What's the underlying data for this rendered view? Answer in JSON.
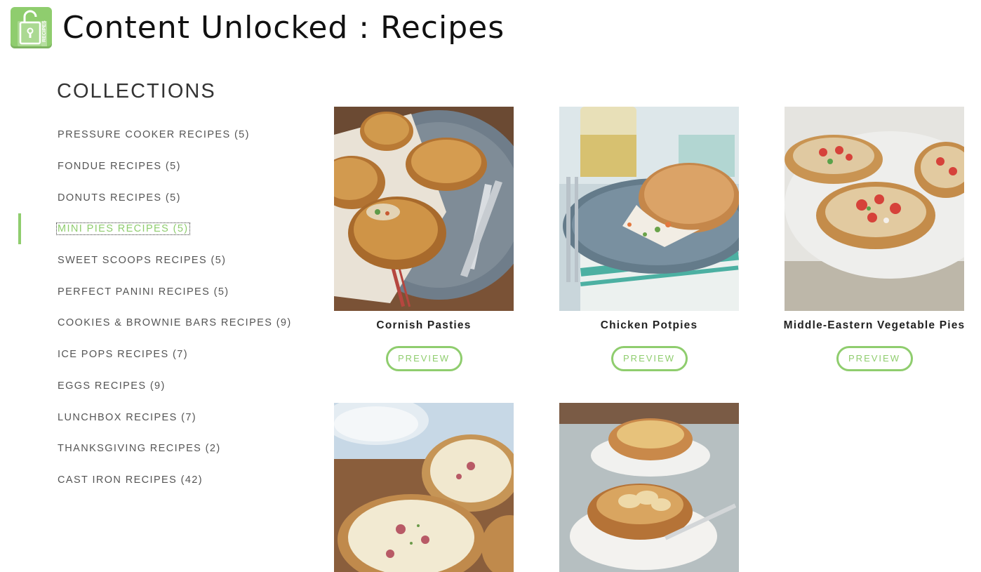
{
  "header": {
    "title": "Content Unlocked : Recipes",
    "logo_icon": "unlocked-book-icon",
    "logo_text": "RECIPES",
    "brand_color": "#8fcd6e"
  },
  "sidebar": {
    "heading": "COLLECTIONS",
    "items": [
      {
        "label": "PRESSURE COOKER RECIPES (5)",
        "active": false
      },
      {
        "label": "FONDUE RECIPES (5)",
        "active": false
      },
      {
        "label": "DONUTS RECIPES (5)",
        "active": false
      },
      {
        "label": "MINI PIES RECIPES (5)",
        "active": true
      },
      {
        "label": "SWEET SCOOPS RECIPES (5)",
        "active": false
      },
      {
        "label": "PERFECT PANINI RECIPES (5)",
        "active": false
      },
      {
        "label": "COOKIES & BROWNIE BARS RECIPES (9)",
        "active": false
      },
      {
        "label": "ICE POPS RECIPES (7)",
        "active": false
      },
      {
        "label": "EGGS RECIPES (9)",
        "active": false
      },
      {
        "label": "LUNCHBOX RECIPES (7)",
        "active": false
      },
      {
        "label": "THANKSGIVING RECIPES (2)",
        "active": false
      },
      {
        "label": "CAST IRON RECIPES (42)",
        "active": false
      }
    ]
  },
  "recipes": [
    {
      "title": "Cornish Pasties",
      "preview_label": "PREVIEW",
      "image_icon": "cornish-pasties-photo"
    },
    {
      "title": "Chicken Potpies",
      "preview_label": "PREVIEW",
      "image_icon": "chicken-potpies-photo"
    },
    {
      "title": "Middle-Eastern Vegetable Pies",
      "preview_label": "PREVIEW",
      "image_icon": "vegetable-pies-photo"
    },
    {
      "title": "",
      "preview_label": "",
      "image_icon": "quiche-photo"
    },
    {
      "title": "",
      "preview_label": "",
      "image_icon": "apple-pies-photo"
    }
  ]
}
